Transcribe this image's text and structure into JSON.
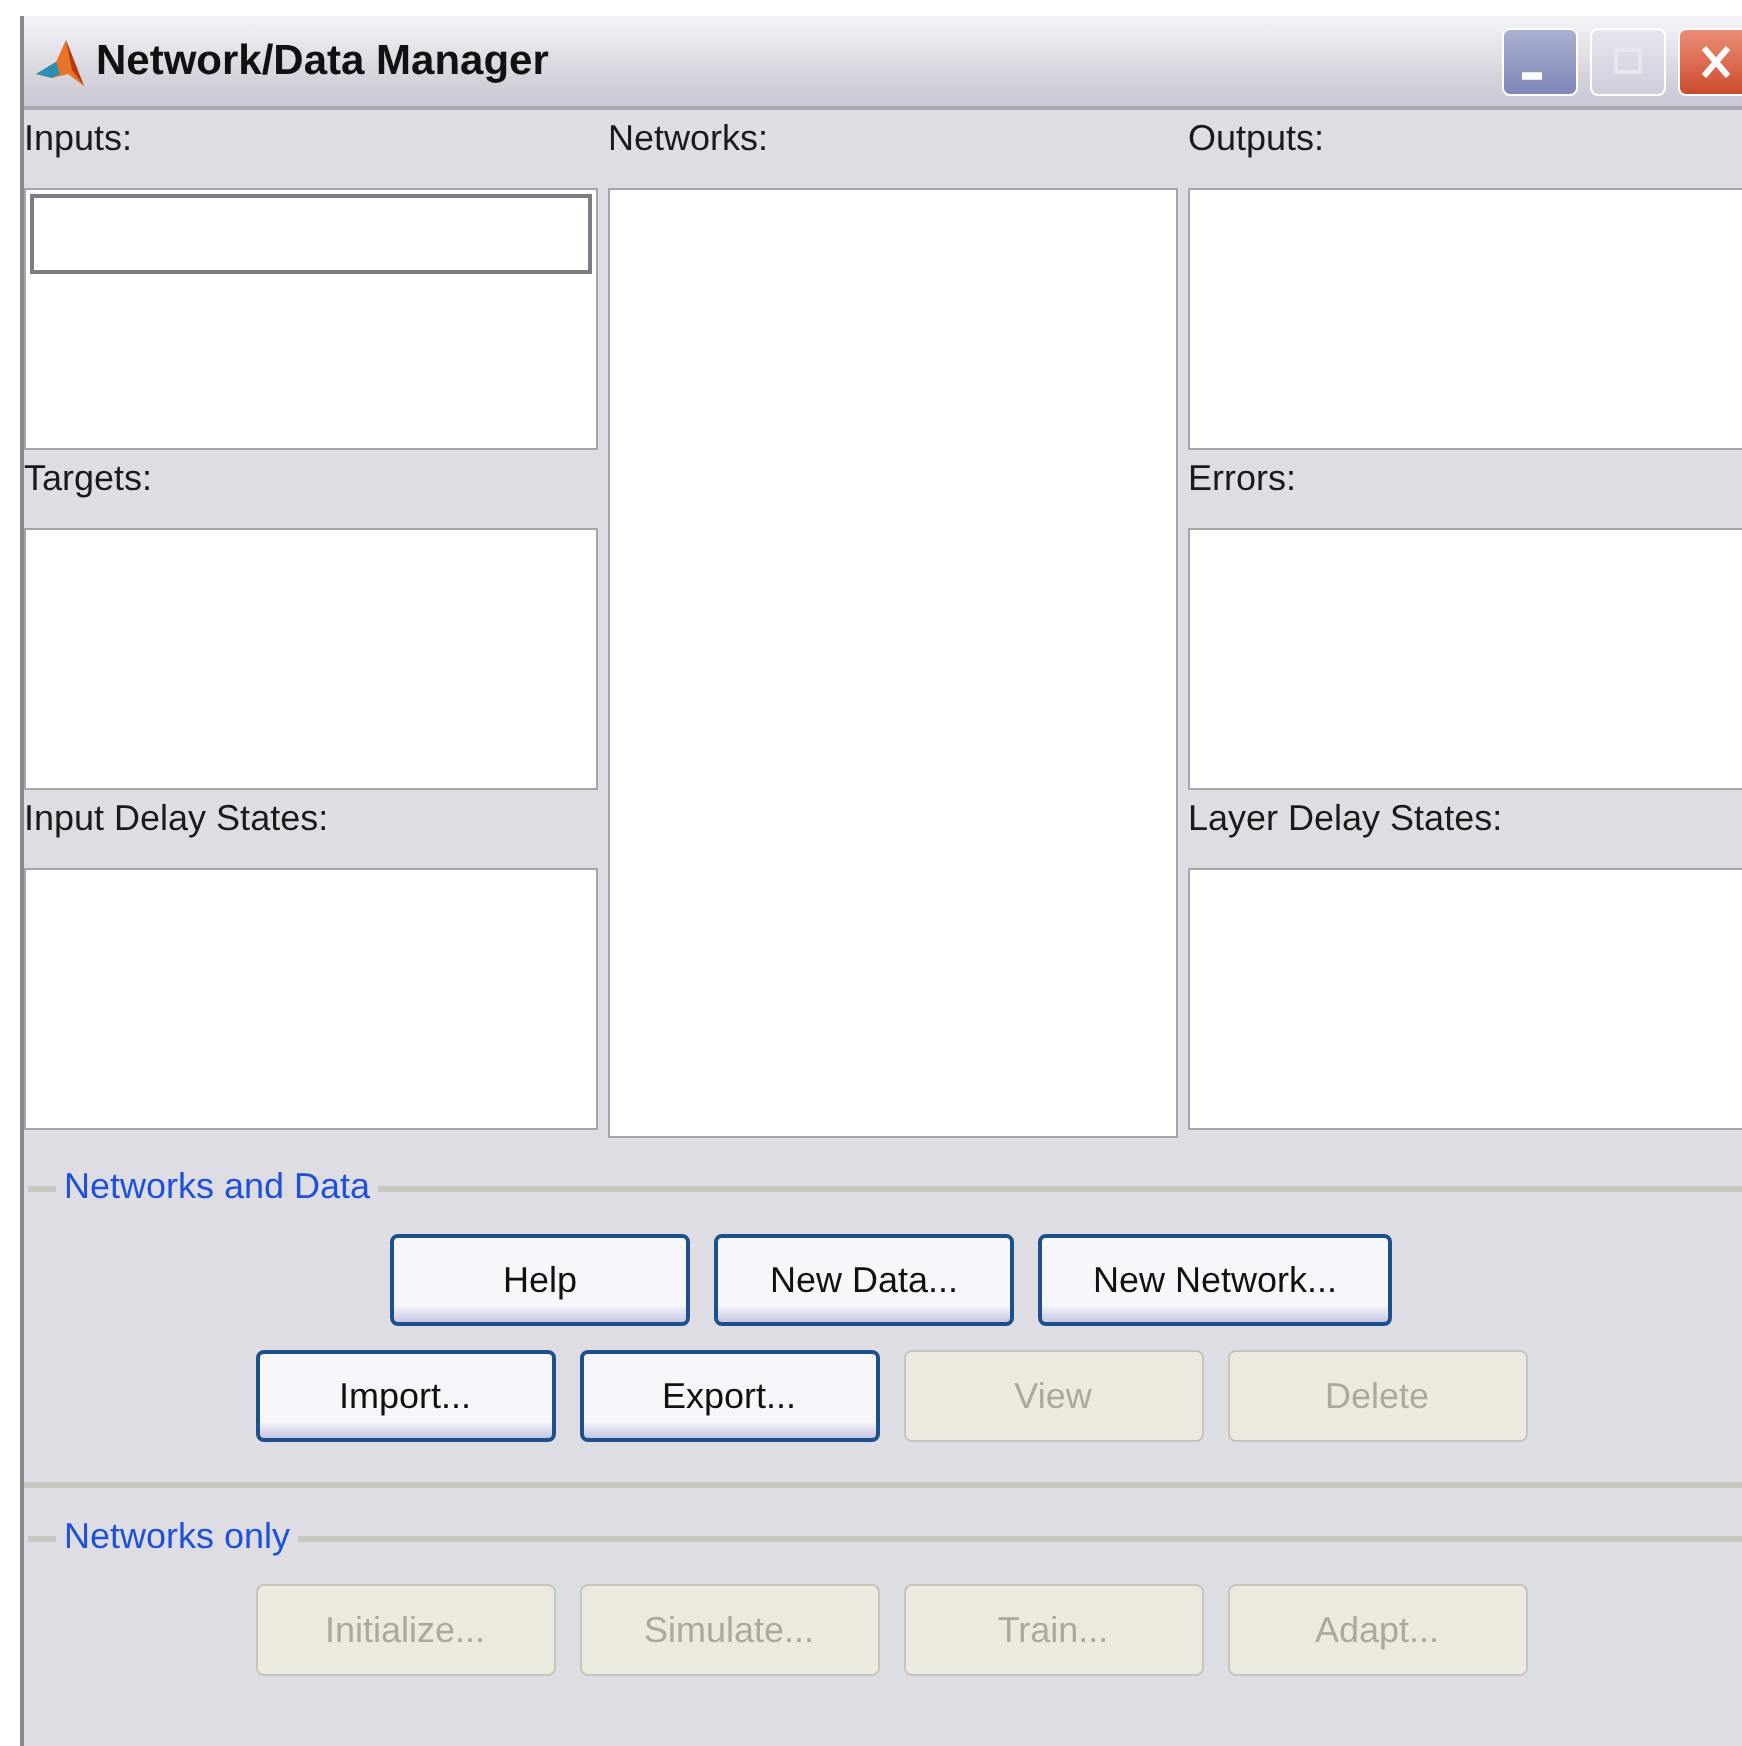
{
  "window": {
    "title": "Network/Data Manager",
    "controls": [
      {
        "kind": "minimize",
        "disabled": false
      },
      {
        "kind": "maximize",
        "disabled": true
      },
      {
        "kind": "close",
        "disabled": false
      }
    ]
  },
  "left_panels": [
    {
      "label": "Inputs:",
      "focused": true
    },
    {
      "label": "Targets:",
      "focused": false
    },
    {
      "label": "Input Delay States:",
      "focused": false
    }
  ],
  "networks_panel": {
    "label": "Networks:"
  },
  "right_panels": [
    {
      "label": "Outputs:",
      "focused": false
    },
    {
      "label": "Errors:",
      "focused": false
    },
    {
      "label": "Layer Delay States:",
      "focused": false
    }
  ],
  "groups": [
    {
      "title": "Networks and Data",
      "rows": [
        [
          {
            "label": "Help",
            "disabled": false
          },
          {
            "label": "New Data...",
            "disabled": false
          },
          {
            "label": "New Network...",
            "disabled": false,
            "kind": "wide"
          }
        ],
        [
          {
            "label": "Import...",
            "disabled": false
          },
          {
            "label": "Export...",
            "disabled": false
          },
          {
            "label": "View",
            "disabled": true
          },
          {
            "label": "Delete",
            "disabled": true
          }
        ]
      ]
    },
    {
      "title": "Networks only",
      "rows": [
        [
          {
            "label": "Initialize...",
            "disabled": true
          },
          {
            "label": "Simulate...",
            "disabled": true
          },
          {
            "label": "Train...",
            "disabled": true
          },
          {
            "label": "Adapt...",
            "disabled": true
          }
        ]
      ]
    }
  ]
}
